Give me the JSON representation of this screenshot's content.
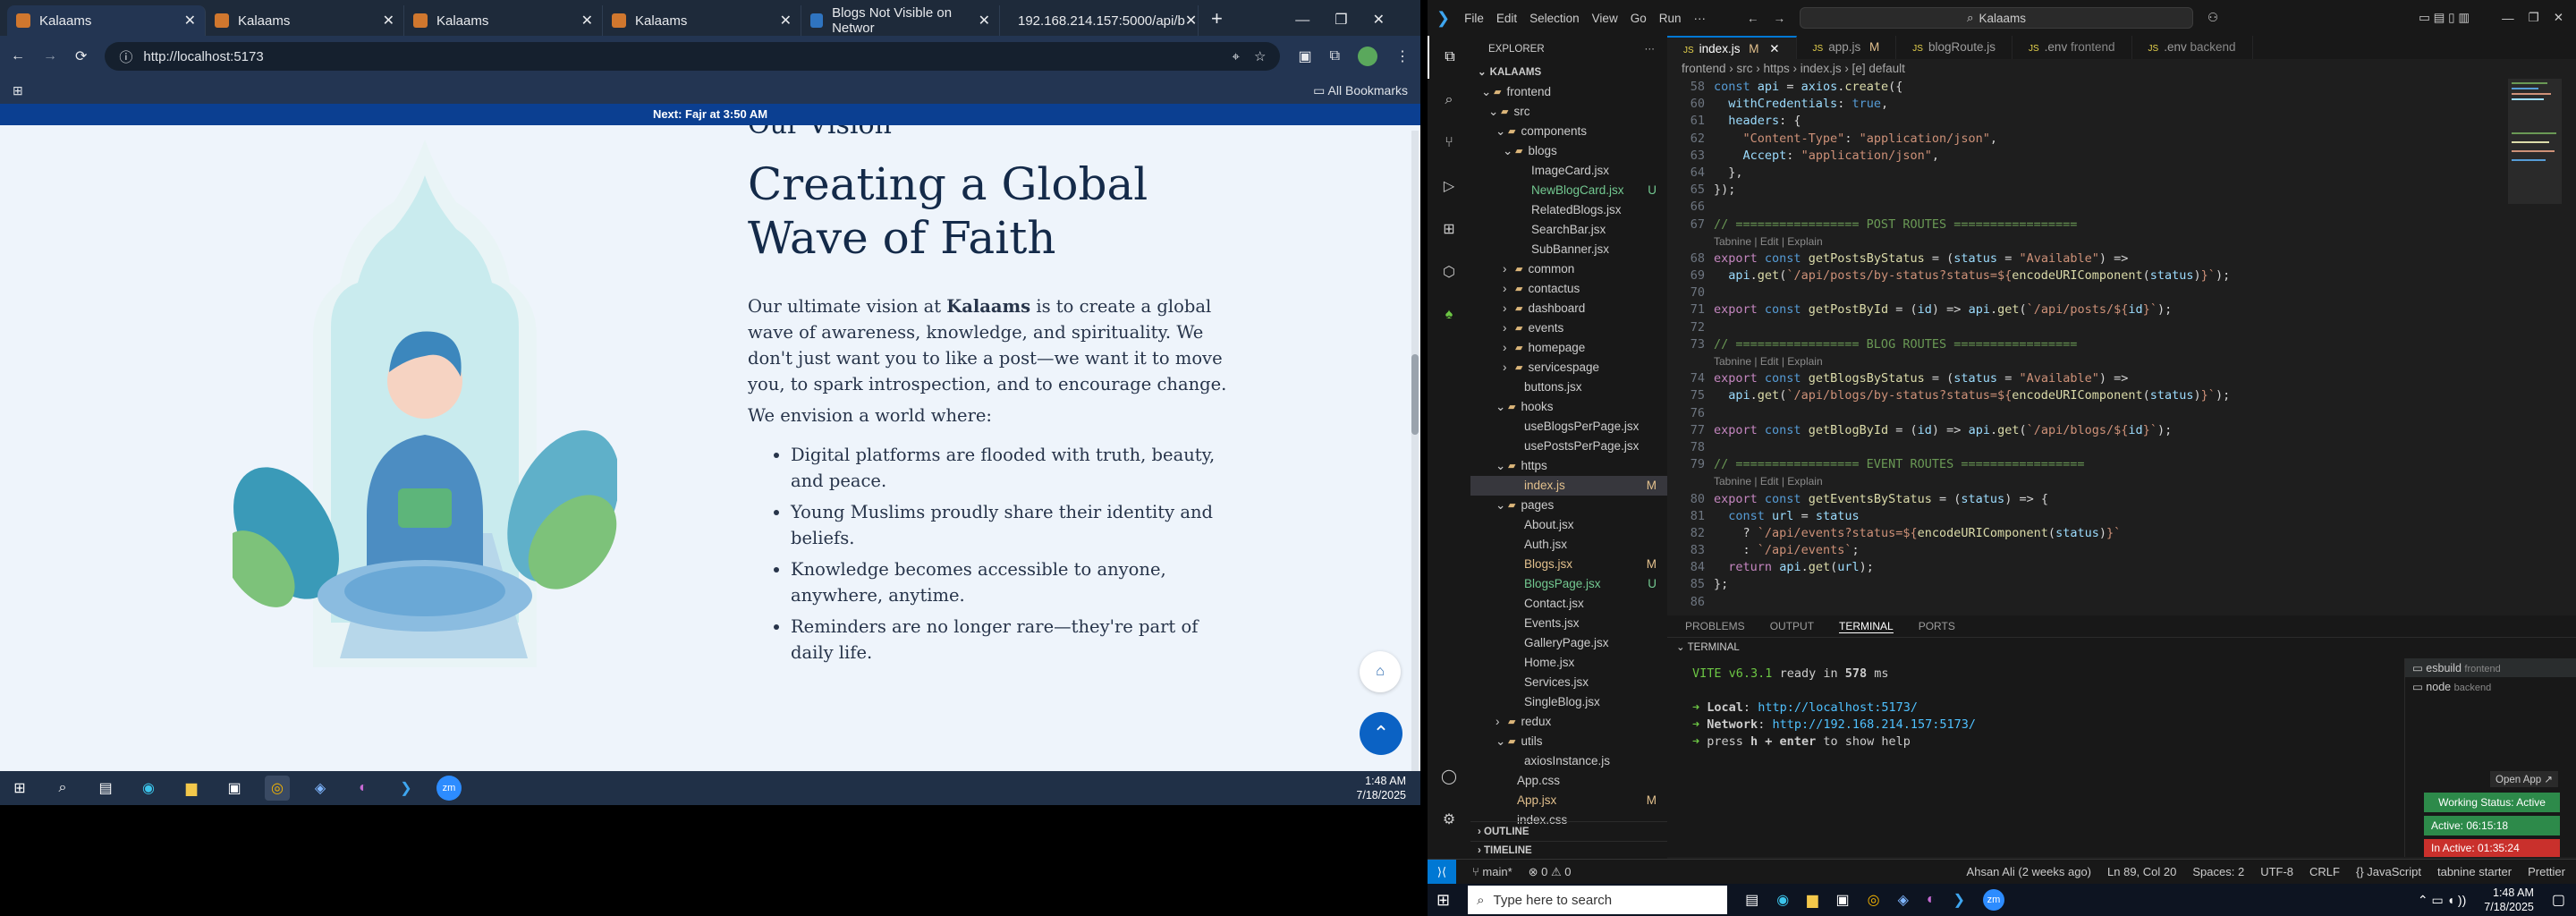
{
  "browser": {
    "tabs": [
      {
        "title": "Kalaams",
        "active": true
      },
      {
        "title": "Kalaams"
      },
      {
        "title": "Kalaams"
      },
      {
        "title": "Kalaams"
      },
      {
        "title": "Blogs Not Visible on Networ"
      },
      {
        "title": "192.168.214.157:5000/api/b"
      }
    ],
    "url": "http://localhost:5173",
    "bookmarks_label": "All Bookmarks"
  },
  "site": {
    "notice": "Next: Fajr at 3:50 AM",
    "cut_heading": "Our Vision",
    "title": "Creating a Global Wave of Faith",
    "para_prefix": "Our ultimate vision at ",
    "brand": "Kalaams",
    "para_suffix": " is to create a global wave of awareness, knowledge, and spirituality. We don't just want you to like a post—we want it to move you, to spark introspection, and to encourage change.",
    "envision": "We envision a world where:",
    "bullets": [
      "Digital platforms are flooded with truth, beauty, and peace.",
      "Young Muslims proudly share their identity and beliefs.",
      "Knowledge becomes accessible to anyone, anywhere, anytime.",
      "Reminders are no longer rare—they're part of daily life."
    ]
  },
  "left_taskbar": {
    "time": "1:48 AM",
    "date": "7/18/2025"
  },
  "vscode": {
    "menu": [
      "File",
      "Edit",
      "Selection",
      "View",
      "Go",
      "Run",
      "···"
    ],
    "search": "Kalaams",
    "explorer_title": "EXPLORER",
    "project": "KALAAMS",
    "tree": [
      {
        "name": "frontend",
        "indent": 1,
        "type": "folder-open"
      },
      {
        "name": "src",
        "indent": 2,
        "type": "folder-open"
      },
      {
        "name": "components",
        "indent": 3,
        "type": "folder-open"
      },
      {
        "name": "blogs",
        "indent": 4,
        "type": "folder-open"
      },
      {
        "name": "ImageCard.jsx",
        "indent": 5,
        "type": "file"
      },
      {
        "name": "NewBlogCard.jsx",
        "indent": 5,
        "type": "file",
        "mark": "U",
        "color": "#73c991"
      },
      {
        "name": "RelatedBlogs.jsx",
        "indent": 5,
        "type": "file"
      },
      {
        "name": "SearchBar.jsx",
        "indent": 5,
        "type": "file"
      },
      {
        "name": "SubBanner.jsx",
        "indent": 5,
        "type": "file"
      },
      {
        "name": "common",
        "indent": 4,
        "type": "folder"
      },
      {
        "name": "contactus",
        "indent": 4,
        "type": "folder"
      },
      {
        "name": "dashboard",
        "indent": 4,
        "type": "folder"
      },
      {
        "name": "events",
        "indent": 4,
        "type": "folder"
      },
      {
        "name": "homepage",
        "indent": 4,
        "type": "folder"
      },
      {
        "name": "servicespage",
        "indent": 4,
        "type": "folder"
      },
      {
        "name": "buttons.jsx",
        "indent": 4,
        "type": "file"
      },
      {
        "name": "hooks",
        "indent": 3,
        "type": "folder-open"
      },
      {
        "name": "useBlogsPerPage.jsx",
        "indent": 4,
        "type": "file"
      },
      {
        "name": "usePostsPerPage.jsx",
        "indent": 4,
        "type": "file"
      },
      {
        "name": "https",
        "indent": 3,
        "type": "folder-open"
      },
      {
        "name": "index.js",
        "indent": 4,
        "type": "file",
        "mark": "M",
        "color": "#e2c08d",
        "selected": true
      },
      {
        "name": "pages",
        "indent": 3,
        "type": "folder-open"
      },
      {
        "name": "About.jsx",
        "indent": 4,
        "type": "file"
      },
      {
        "name": "Auth.jsx",
        "indent": 4,
        "type": "file"
      },
      {
        "name": "Blogs.jsx",
        "indent": 4,
        "type": "file",
        "mark": "M",
        "color": "#e2c08d"
      },
      {
        "name": "BlogsPage.jsx",
        "indent": 4,
        "type": "file",
        "mark": "U",
        "color": "#73c991"
      },
      {
        "name": "Contact.jsx",
        "indent": 4,
        "type": "file"
      },
      {
        "name": "Events.jsx",
        "indent": 4,
        "type": "file"
      },
      {
        "name": "GalleryPage.jsx",
        "indent": 4,
        "type": "file"
      },
      {
        "name": "Home.jsx",
        "indent": 4,
        "type": "file"
      },
      {
        "name": "Services.jsx",
        "indent": 4,
        "type": "file"
      },
      {
        "name": "SingleBlog.jsx",
        "indent": 4,
        "type": "file"
      },
      {
        "name": "redux",
        "indent": 3,
        "type": "folder"
      },
      {
        "name": "utils",
        "indent": 3,
        "type": "folder-open"
      },
      {
        "name": "axiosInstance.js",
        "indent": 4,
        "type": "file"
      },
      {
        "name": "App.css",
        "indent": 3,
        "type": "file"
      },
      {
        "name": "App.jsx",
        "indent": 3,
        "type": "file",
        "mark": "M",
        "color": "#e2c08d"
      },
      {
        "name": "index.css",
        "indent": 3,
        "type": "file"
      }
    ],
    "outline": "OUTLINE",
    "timeline": "TIMELINE",
    "editor_tabs": [
      {
        "name": "index.js",
        "mark": "M",
        "active": true
      },
      {
        "name": "app.js",
        "mark": "M"
      },
      {
        "name": "blogRoute.js"
      },
      {
        "name": ".env",
        "suffix": "frontend"
      },
      {
        "name": ".env",
        "suffix": "backend"
      }
    ],
    "breadcrumb": "frontend  ›  src  ›  https  ›  index.js  ›  [e] default",
    "code_lines": [
      {
        "n": "58",
        "html": "<span class='kw'>const</span> <span class='var'>api</span> <span class='pl'>=</span> <span class='var'>axios</span><span class='pl'>.</span><span class='fn'>create</span><span class='pl'>({</span>"
      },
      {
        "n": "60",
        "html": "  <span class='var'>withCredentials</span><span class='pl'>:</span> <span class='kw'>true</span><span class='pl'>,</span>"
      },
      {
        "n": "61",
        "html": "  <span class='var'>headers</span><span class='pl'>: {</span>"
      },
      {
        "n": "62",
        "html": "    <span class='str'>\"Content-Type\"</span><span class='pl'>:</span> <span class='str'>\"application/json\"</span><span class='pl'>,</span>"
      },
      {
        "n": "63",
        "html": "    <span class='var'>Accept</span><span class='pl'>:</span> <span class='str'>\"application/json\"</span><span class='pl'>,</span>"
      },
      {
        "n": "64",
        "html": "  <span class='pl'>},</span>"
      },
      {
        "n": "65",
        "html": "<span class='pl'>});</span>"
      },
      {
        "n": "66",
        "html": ""
      },
      {
        "n": "67",
        "html": "<span class='cm'>// ================= POST ROUTES =================</span>"
      },
      {
        "n": "",
        "html": "<span style='color:#8b8b8b;font-family:Liberation Sans,sans-serif;font-size:12px'>Tabnine | Edit | Explain</span>"
      },
      {
        "n": "68",
        "html": "<span class='pu'>export</span> <span class='kw'>const</span> <span class='fn'>getPostsByStatus</span> <span class='pl'>= (</span><span class='var'>status</span> <span class='pl'>=</span> <span class='str'>\"Available\"</span><span class='pl'>) =></span>"
      },
      {
        "n": "69",
        "html": "  <span class='var'>api</span><span class='pl'>.</span><span class='fn'>get</span><span class='pl'>(</span><span class='str'>`/api/posts/by-status?status=${</span><span class='fn'>encodeURIComponent</span><span class='pl'>(</span><span class='var'>status</span><span class='pl'>)</span><span class='str'>}`</span><span class='pl'>);</span>"
      },
      {
        "n": "70",
        "html": ""
      },
      {
        "n": "71",
        "html": "<span class='pu'>export</span> <span class='kw'>const</span> <span class='fn'>getPostById</span> <span class='pl'>= (</span><span class='var'>id</span><span class='pl'>) =></span> <span class='var'>api</span><span class='pl'>.</span><span class='fn'>get</span><span class='pl'>(</span><span class='str'>`/api/posts/${</span><span class='var'>id</span><span class='str'>}`</span><span class='pl'>);</span>"
      },
      {
        "n": "72",
        "html": ""
      },
      {
        "n": "73",
        "html": "<span class='cm'>// ================= BLOG ROUTES =================</span>"
      },
      {
        "n": "",
        "html": "<span style='color:#8b8b8b;font-family:Liberation Sans,sans-serif;font-size:12px'>Tabnine | Edit | Explain</span>"
      },
      {
        "n": "74",
        "html": "<span class='pu'>export</span> <span class='kw'>const</span> <span class='fn'>getBlogsByStatus</span> <span class='pl'>= (</span><span class='var'>status</span> <span class='pl'>=</span> <span class='str'>\"Available\"</span><span class='pl'>) =></span>"
      },
      {
        "n": "75",
        "html": "  <span class='var'>api</span><span class='pl'>.</span><span class='fn'>get</span><span class='pl'>(</span><span class='str'>`/api/blogs/by-status?status=${</span><span class='fn'>encodeURIComponent</span><span class='pl'>(</span><span class='var'>status</span><span class='pl'>)</span><span class='str'>}`</span><span class='pl'>);</span>"
      },
      {
        "n": "76",
        "html": ""
      },
      {
        "n": "77",
        "html": "<span class='pu'>export</span> <span class='kw'>const</span> <span class='fn'>getBlogById</span> <span class='pl'>= (</span><span class='var'>id</span><span class='pl'>) =></span> <span class='var'>api</span><span class='pl'>.</span><span class='fn'>get</span><span class='pl'>(</span><span class='str'>`/api/blogs/${</span><span class='var'>id</span><span class='str'>}`</span><span class='pl'>);</span>"
      },
      {
        "n": "78",
        "html": ""
      },
      {
        "n": "79",
        "html": "<span class='cm'>// ================= EVENT ROUTES =================</span>"
      },
      {
        "n": "",
        "html": "<span style='color:#8b8b8b;font-family:Liberation Sans,sans-serif;font-size:12px'>Tabnine | Edit | Explain</span>"
      },
      {
        "n": "80",
        "html": "<span class='pu'>export</span> <span class='kw'>const</span> <span class='fn'>getEventsByStatus</span> <span class='pl'>= (</span><span class='var'>status</span><span class='pl'>) => {</span>"
      },
      {
        "n": "81",
        "html": "  <span class='kw'>const</span> <span class='var'>url</span> <span class='pl'>=</span> <span class='var'>status</span>"
      },
      {
        "n": "82",
        "html": "    <span class='pl'>?</span> <span class='str'>`/api/events?status=${</span><span class='fn'>encodeURIComponent</span><span class='pl'>(</span><span class='var'>status</span><span class='pl'>)</span><span class='str'>}`</span>"
      },
      {
        "n": "83",
        "html": "    <span class='pl'>:</span> <span class='str'>`/api/events`</span><span class='pl'>;</span>"
      },
      {
        "n": "84",
        "html": "  <span class='pu'>return</span> <span class='var'>api</span><span class='pl'>.</span><span class='fn'>get</span><span class='pl'>(</span><span class='var'>url</span><span class='pl'>);</span>"
      },
      {
        "n": "85",
        "html": "<span class='pl'>};</span>"
      },
      {
        "n": "86",
        "html": ""
      }
    ],
    "panel_tabs": [
      "PROBLEMS",
      "OUTPUT",
      "TERMINAL",
      "PORTS"
    ],
    "terminal_label": "TERMINAL",
    "terminal_lines": [
      "<span style='color:#6cc644'>VITE</span> <span style='color:#6cc644'>v6.3.1</span>  ready in <b>578</b> ms",
      "",
      "<span style='color:#6cc644'>➜</span>  <b>Local</b>:   <span style='color:#4fc1ff'>http://localhost:5173/</span>",
      "<span style='color:#6cc644'>➜</span>  <b>Network</b>: <span style='color:#4fc1ff'>http://192.168.214.157:5173/</span>",
      "<span style='color:#6cc644'>➜</span>  press <b>h + enter</b> to show help"
    ],
    "terminals": [
      {
        "name": "esbuild",
        "sub": "frontend"
      },
      {
        "name": "node",
        "sub": "backend"
      }
    ],
    "open_app": "Open App ↗",
    "work_status": "Working Status: Active",
    "active_time": "Active: 06:15:18",
    "inactive_time": "In Active: 01:35:24",
    "status_left": "main*",
    "status_problems": "⊗ 0 ⚠ 0",
    "status_right": [
      "Ahsan Ali (2 weeks ago)",
      "Ln 89, Col 20",
      "Spaces: 2",
      "UTF-8",
      "CRLF",
      "{} JavaScript",
      "tabnine starter",
      "Prettier"
    ]
  },
  "win_taskbar": {
    "search": "Type here to search",
    "time": "1:48 AM",
    "date": "7/18/2025"
  }
}
